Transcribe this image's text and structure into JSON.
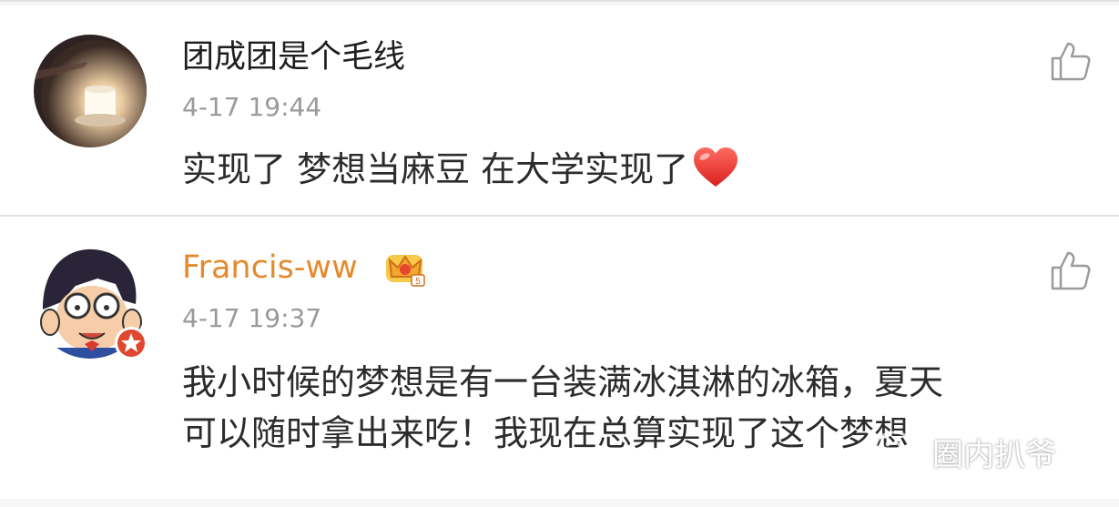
{
  "comments": [
    {
      "username": "团成团是个毛线",
      "timestamp": "4-17 19:44",
      "text_lines": [
        "实现了 梦想当麻豆 在大学实现了"
      ],
      "emoji": "heart-icon",
      "avatar": "candle-avatar",
      "like_icon": "thumbs-up-icon"
    },
    {
      "username": "Francis-ww",
      "timestamp": "4-17 19:37",
      "text_lines": [
        "我小时候的梦想是有一台装满冰淇淋的冰箱，夏天",
        "可以随时拿出来吃！我现在总算实现了这个梦想"
      ],
      "badge": "vip-crown-icon",
      "avatar": "cartoon-avatar",
      "like_icon": "thumbs-up-icon"
    }
  ],
  "watermark": {
    "text": "圈内扒爷",
    "icon": "wechat-icon"
  },
  "colors": {
    "username_vip": "#e58a2c",
    "timestamp": "#9a9a9a",
    "heart": "#e8322f"
  }
}
